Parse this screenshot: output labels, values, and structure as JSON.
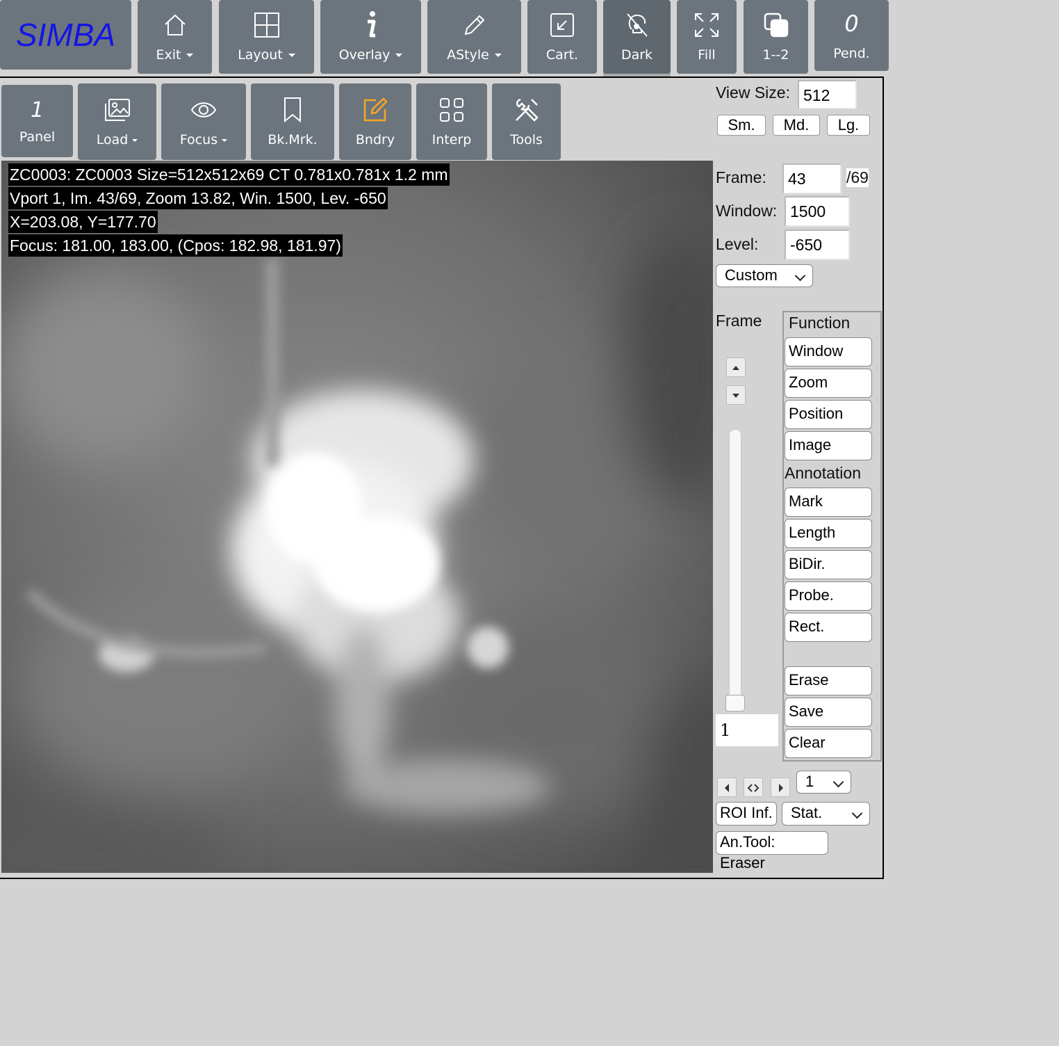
{
  "brand": "SIMBA",
  "toolbar_top": [
    {
      "label": "Exit",
      "icon": "home-icon",
      "dropdown": true
    },
    {
      "label": "Layout",
      "icon": "grid-icon",
      "dropdown": true
    },
    {
      "label": "Overlay",
      "icon": "info-icon",
      "dropdown": true
    },
    {
      "label": "AStyle",
      "icon": "pencil-icon",
      "dropdown": true
    },
    {
      "label": "Cart.",
      "icon": "arrow-in-box-icon",
      "dropdown": false
    },
    {
      "label": "Dark",
      "icon": "lightbulb-off-icon",
      "dropdown": false
    },
    {
      "label": "Fill",
      "icon": "expand-icon",
      "dropdown": false
    },
    {
      "label": "1--2",
      "icon": "overlap-squares-icon",
      "dropdown": false
    },
    {
      "label": "Pend.",
      "icon_text": "0",
      "dropdown": false
    }
  ],
  "toolbar_second": [
    {
      "label": "Panel",
      "icon_text": "1",
      "dropdown": false
    },
    {
      "label": "Load",
      "icon": "image-icon",
      "dropdown": true
    },
    {
      "label": "Focus",
      "icon": "eye-icon",
      "dropdown": true
    },
    {
      "label": "Bk.Mrk.",
      "icon": "bookmark-icon",
      "dropdown": false
    },
    {
      "label": "Bndry",
      "icon": "edit-square-icon",
      "dropdown": false
    },
    {
      "label": "Interp",
      "icon": "four-squares-icon",
      "dropdown": false
    },
    {
      "label": "Tools",
      "icon": "tools-icon",
      "dropdown": false
    }
  ],
  "overlay_lines": [
    "ZC0003: ZC0003 Size=512x512x69 CT 0.781x0.781x 1.2 mm",
    "Vport 1, Im. 43/69, Zoom 13.82, Win. 1500, Lev. -650",
    "X=203.08, Y=177.70",
    "Focus: 181.00, 183.00, (Cpos: 182.98, 181.97)"
  ],
  "view_size": {
    "label": "View Size:",
    "value": "512",
    "sm": "Sm.",
    "md": "Md.",
    "lg": "Lg."
  },
  "frame": {
    "label": "Frame:",
    "value": "43",
    "total": "/69"
  },
  "window": {
    "label": "Window:",
    "value": "1500"
  },
  "level": {
    "label": "Level:",
    "value": "-650"
  },
  "preset": {
    "selected": "Custom"
  },
  "frame_slider": {
    "label": "Frame",
    "value_text": "1",
    "position_fraction": 1.0
  },
  "function_panel": {
    "title": "Function",
    "function_buttons": [
      "Window",
      "Zoom",
      "Position",
      "Image"
    ],
    "annotation_title": "Annotation",
    "annotation_buttons": [
      "Mark",
      "Length",
      "BiDir.",
      "Probe.",
      "Rect."
    ],
    "action_buttons": [
      "Erase",
      "Save",
      "Clear"
    ]
  },
  "roi_nav": {
    "selected": "1"
  },
  "roi_info_label": "ROI Inf.",
  "stat_select": "Stat.",
  "an_tool_label": "An.Tool: Eraser"
}
